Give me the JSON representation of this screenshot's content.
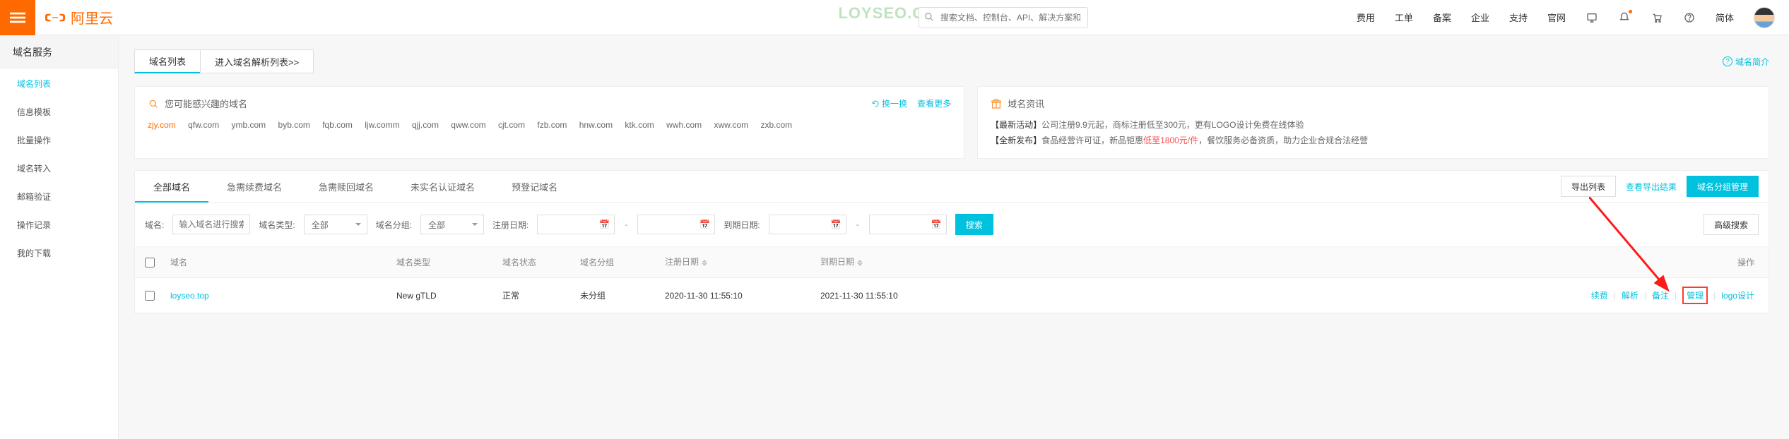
{
  "watermark": "LOYSEO.COM",
  "top": {
    "brand": "阿里云",
    "search_placeholder": "搜索文档、控制台、API、解决方案和资源",
    "nav": [
      "费用",
      "工单",
      "备案",
      "企业",
      "支持",
      "官网"
    ],
    "lang": "简体"
  },
  "sidebar": {
    "title": "域名服务",
    "items": [
      "域名列表",
      "信息模板",
      "批量操作",
      "域名转入",
      "邮箱验证",
      "操作记录",
      "我的下载"
    ]
  },
  "page_tabs": {
    "list": "域名列表",
    "dns": "进入域名解析列表>>",
    "help": "域名简介"
  },
  "suggest": {
    "title": "您可能感兴趣的域名",
    "refresh": "换一换",
    "more": "查看更多",
    "hot": "zjy.com",
    "rest": [
      "qfw.com",
      "ymb.com",
      "byb.com",
      "fqb.com",
      "ljw.comm",
      "qjj.com",
      "qww.com",
      "cjt.com",
      "fzb.com",
      "hnw.com",
      "ktk.com",
      "wwh.com",
      "xww.com",
      "zxb.com"
    ]
  },
  "news": {
    "title": "域名资讯",
    "line1_tag": "【最新活动】",
    "line1_txt": "公司注册9.9元起，商标注册低至300元，更有LOGO设计免费在线体验",
    "line2_tag": "【全新发布】",
    "line2_a": "食品经营许可证，新品钜惠",
    "line2_red": "低至1800元/件",
    "line2_b": "，餐饮服务必备资质，助力企业合规合法经营"
  },
  "subtabs": [
    "全部域名",
    "急需续费域名",
    "急需赎回域名",
    "未实名认证域名",
    "预登记域名"
  ],
  "actions": {
    "export": "导出列表",
    "view_export": "查看导出结果",
    "group": "域名分组管理"
  },
  "filters": {
    "domain_label": "域名:",
    "domain_ph": "输入域名进行搜索",
    "type_label": "域名类型:",
    "type_val": "全部",
    "group_label": "域名分组:",
    "group_val": "全部",
    "reg_label": "注册日期:",
    "exp_label": "到期日期:",
    "dash": "-",
    "search": "搜索",
    "adv": "高级搜索"
  },
  "thead": {
    "name": "域名",
    "type": "域名类型",
    "status": "域名状态",
    "group": "域名分组",
    "reg": "注册日期",
    "exp": "到期日期",
    "act": "操作"
  },
  "row": {
    "domain": "loyseo.top",
    "type": "New gTLD",
    "status": "正常",
    "group": "未分组",
    "reg": "2020-11-30 11:55:10",
    "exp": "2021-11-30 11:55:10",
    "renew": "续费",
    "resolve": "解析",
    "remark": "备注",
    "manage": "管理",
    "logo": "logo设计",
    "sep": "|"
  }
}
